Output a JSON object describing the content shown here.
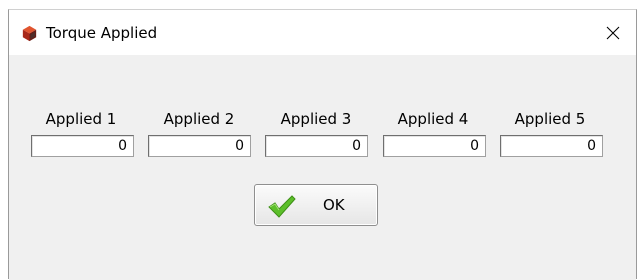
{
  "window": {
    "title": "Torque Applied",
    "app_icon": "cube-app-icon",
    "close_icon": "close-icon"
  },
  "fields": [
    {
      "label": "Applied 1",
      "value": "0"
    },
    {
      "label": "Applied 2",
      "value": "0"
    },
    {
      "label": "Applied 3",
      "value": "0"
    },
    {
      "label": "Applied 4",
      "value": "0"
    },
    {
      "label": "Applied 5",
      "value": "0"
    }
  ],
  "ok_button": {
    "label": "OK",
    "icon": "checkmark-icon"
  },
  "colors": {
    "titlebar": "#ffffff",
    "client_background": "#f0f0f0",
    "checkmark": "#4caf1e"
  }
}
